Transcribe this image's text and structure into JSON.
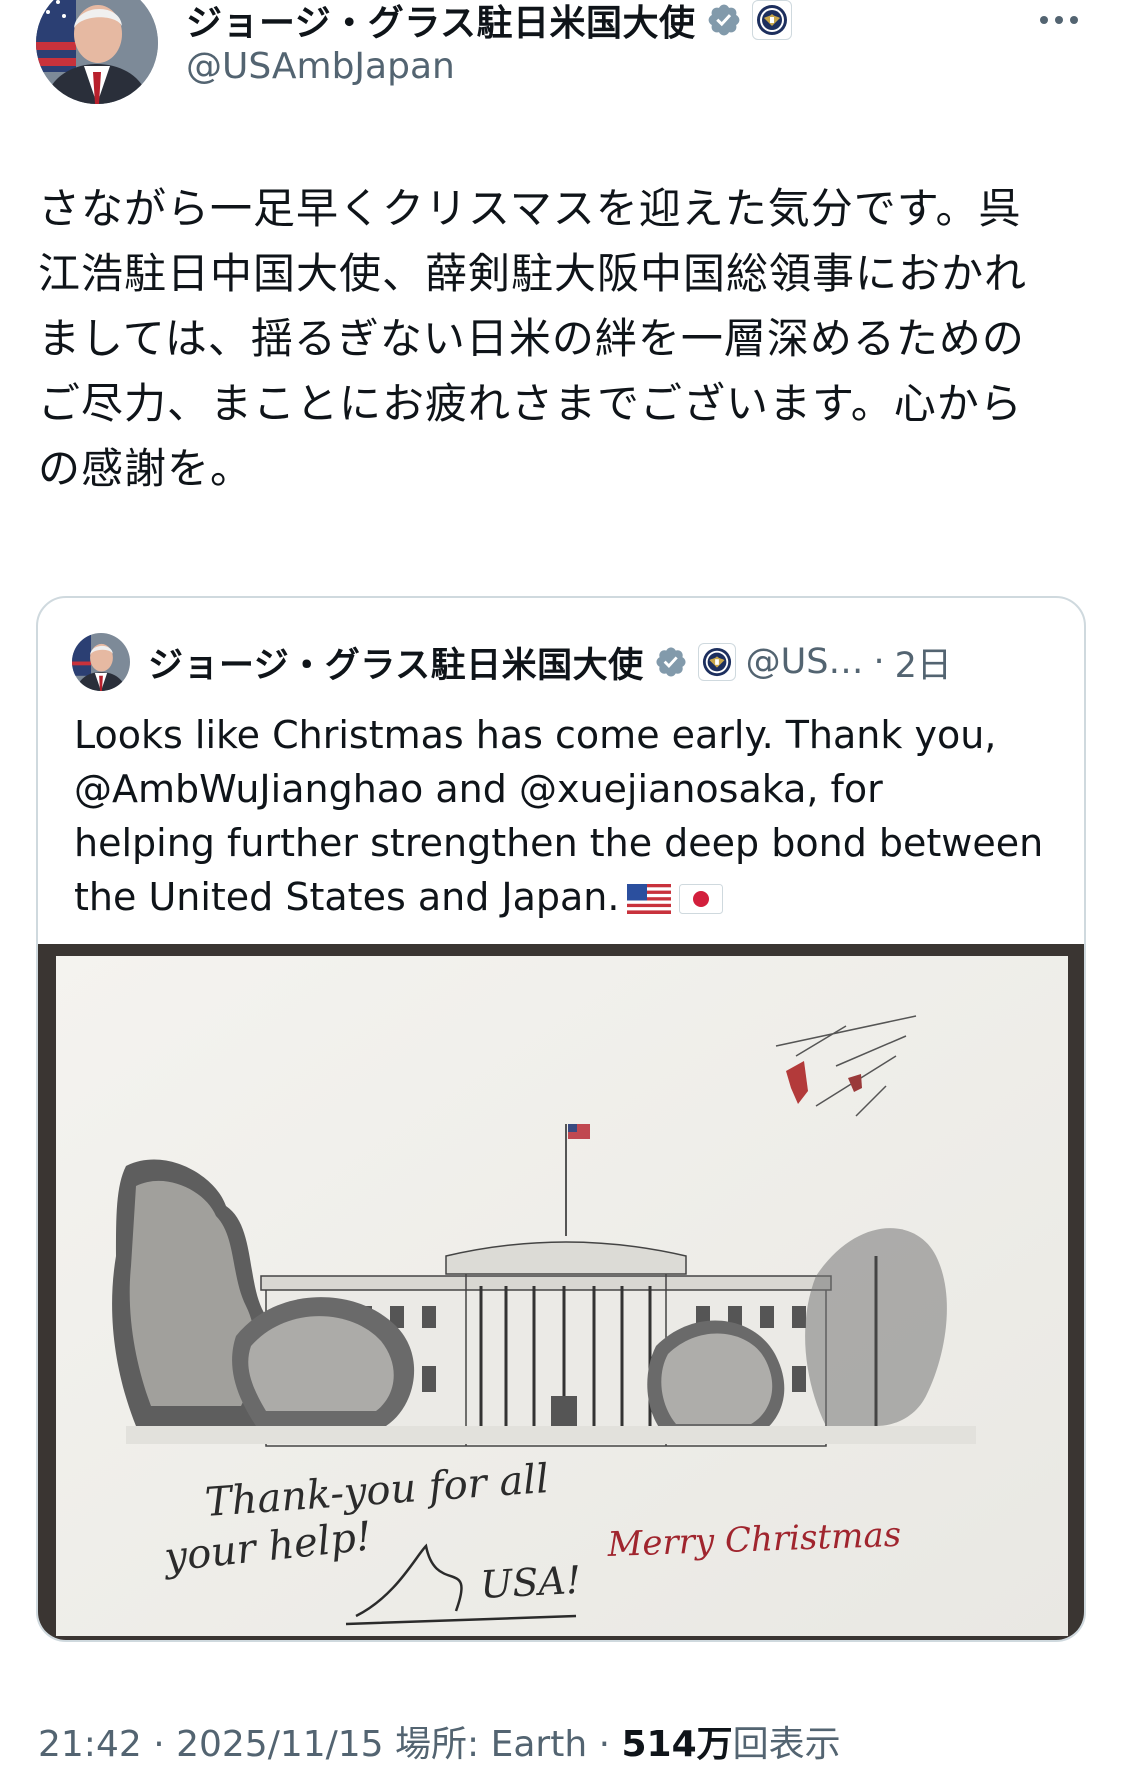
{
  "author": {
    "display_name": "ジョージ・グラス駐日米国大使",
    "handle": "@USAmbJapan",
    "verified_icon": "verified-badge-icon",
    "affiliate_icon": "us-state-dept-seal-icon"
  },
  "tweet": {
    "lines": [
      "さながら一足早くクリスマスを迎えた気分です。呉",
      "江浩駐日中国大使、薛剣駐大阪中国総領事におかれ",
      "ましては、揺るぎない日米の絆を一層深めるための",
      "ご尽力、まことにお疲れさまでございます。心から",
      "の感謝を。"
    ]
  },
  "quoted_tweet": {
    "display_name": "ジョージ・グラス駐日米国大使",
    "handle": "@US…",
    "separator": "·",
    "time": "2日",
    "lines": [
      "Looks like Christmas has come early. Thank you,",
      "@AmbWuJianghao and @xuejianosaka, for",
      "helping further strengthen the deep bond between",
      "the United States and Japan."
    ],
    "flags": [
      "us-flag-icon",
      "japan-flag-icon"
    ],
    "image": {
      "handwritten_line1": "Thank-you for all",
      "handwritten_line2": "your help!",
      "handwritten_sign": "USA!",
      "greeting": "Merry Christmas"
    }
  },
  "meta": {
    "time": "21:42",
    "sep1": " · ",
    "date": "2025/11/15",
    "location": " 場所: Earth",
    "sep2": " · ",
    "views_count": "514万",
    "views_label": "回表示"
  },
  "colors": {
    "text": "#0f1419",
    "secondary": "#536471",
    "verified": "#829aab",
    "border": "#cfd9de"
  }
}
